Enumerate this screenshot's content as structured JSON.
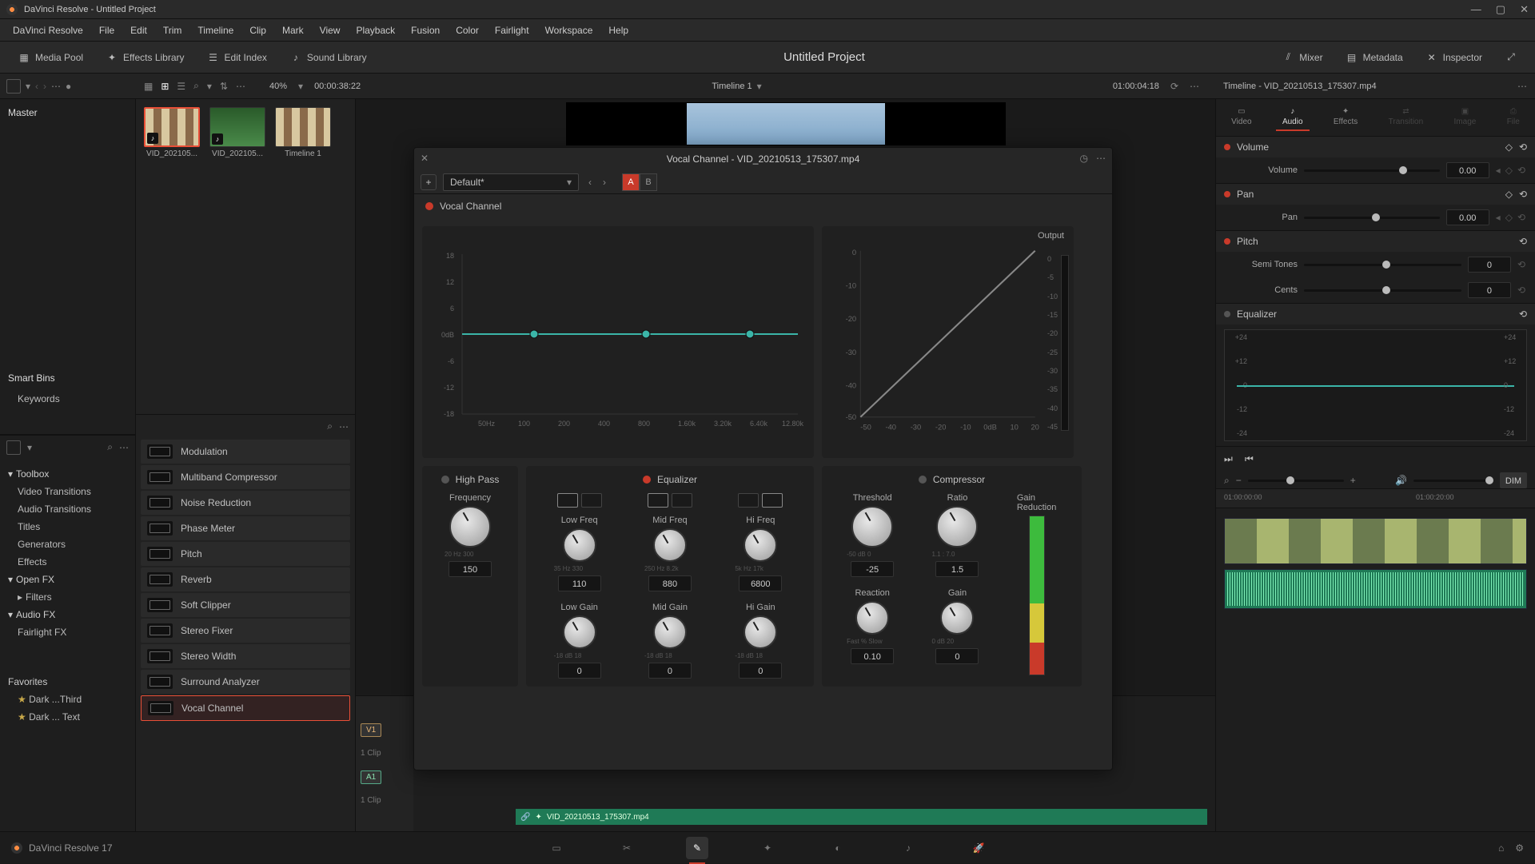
{
  "titlebar": {
    "text": "DaVinci Resolve - Untitled Project"
  },
  "menu": [
    "DaVinci Resolve",
    "File",
    "Edit",
    "Trim",
    "Timeline",
    "Clip",
    "Mark",
    "View",
    "Playback",
    "Fusion",
    "Color",
    "Fairlight",
    "Workspace",
    "Help"
  ],
  "sectoolbar": {
    "mediapool": "Media Pool",
    "effectslib": "Effects Library",
    "editindex": "Edit Index",
    "soundlib": "Sound Library",
    "project": "Untitled Project",
    "mixer": "Mixer",
    "metadata": "Metadata",
    "inspector": "Inspector"
  },
  "toolbarrow": {
    "zoom": "40%",
    "timecode_left": "00:00:38:22",
    "timeline_name": "Timeline 1",
    "timecode_right": "01:00:04:18"
  },
  "mediapool": {
    "master": "Master",
    "smartbins": "Smart Bins",
    "keywords": "Keywords",
    "thumbs": [
      {
        "label": "VID_202105..."
      },
      {
        "label": "VID_202105..."
      },
      {
        "label": "Timeline 1"
      }
    ]
  },
  "effectstree": {
    "toolbox": "Toolbox",
    "items": [
      "Video Transitions",
      "Audio Transitions",
      "Titles",
      "Generators",
      "Effects"
    ],
    "openfx": "Open FX",
    "filters": "Filters",
    "audiofx": "Audio FX",
    "fairlightfx": "Fairlight FX",
    "favorites": "Favorites",
    "favitems": [
      "Dark ...Third",
      "Dark ... Text"
    ]
  },
  "fxlist": [
    "Modulation",
    "Multiband Compressor",
    "Noise Reduction",
    "Phase Meter",
    "Pitch",
    "Reverb",
    "Soft Clipper",
    "Stereo Fixer",
    "Stereo Width",
    "Surround Analyzer",
    "Vocal Channel"
  ],
  "fxlist_selected": "Vocal Channel",
  "vocal_panel": {
    "title": "Vocal Channel - VID_20210513_175307.mp4",
    "preset": "Default*",
    "ab_a": "A",
    "ab_b": "B",
    "channel_label": "Vocal Channel",
    "output_label": "Output",
    "eq_ylabels": [
      "18",
      "12",
      "6",
      "0dB",
      "-6",
      "-12",
      "-18"
    ],
    "eq_xlabels": [
      "50Hz",
      "100",
      "200",
      "400",
      "800",
      "1.60k",
      "3.20k",
      "6.40k",
      "12.80k"
    ],
    "out_ylabels": [
      "0",
      "-10",
      "-20",
      "-30",
      "-40",
      "-50"
    ],
    "out_xlabels": [
      "-50",
      "-40",
      "-30",
      "-20",
      "-10",
      "0dB",
      "10",
      "20"
    ],
    "out_scale_r": [
      "0",
      "-5",
      "-10",
      "-15",
      "-20",
      "-25",
      "-30",
      "-35",
      "-40",
      "-45"
    ],
    "highpass": {
      "title": "High Pass",
      "freq_label": "Frequency",
      "scale": "20   Hz   300",
      "value": "150"
    },
    "equalizer": {
      "title": "Equalizer",
      "low": {
        "freq_label": "Low Freq",
        "freq_scale": "35   Hz   330",
        "freq_val": "110",
        "gain_label": "Low Gain",
        "gain_scale": "-18   dB   18",
        "gain_val": "0"
      },
      "mid": {
        "freq_label": "Mid Freq",
        "freq_scale": "250   Hz   8.2k",
        "freq_val": "880",
        "gain_label": "Mid Gain",
        "gain_scale": "-18   dB   18",
        "gain_val": "0"
      },
      "hi": {
        "freq_label": "Hi Freq",
        "freq_scale": "5k   Hz   17k",
        "freq_val": "6800",
        "gain_label": "Hi Gain",
        "gain_scale": "-18   dB   18",
        "gain_val": "0"
      }
    },
    "compressor": {
      "title": "Compressor",
      "threshold": {
        "label": "Threshold",
        "scale": "-50   dB   0",
        "val": "-25"
      },
      "ratio": {
        "label": "Ratio",
        "scale": "1.1 :   7.0",
        "val": "1.5"
      },
      "gr_label": "Gain Reduction",
      "reaction": {
        "label": "Reaction",
        "scale": "Fast   %   Slow",
        "val": "0.10"
      },
      "gain": {
        "label": "Gain",
        "scale": "0   dB   20",
        "val": "0"
      }
    }
  },
  "inspector": {
    "timeline_title": "Timeline - VID_20210513_175307.mp4",
    "tabs": [
      "Video",
      "Audio",
      "Effects",
      "Transition",
      "Image",
      "File"
    ],
    "active_tab": "Audio",
    "volume": {
      "section": "Volume",
      "label": "Volume",
      "val": "0.00"
    },
    "pan": {
      "section": "Pan",
      "label": "Pan",
      "val": "0.00"
    },
    "pitch": {
      "section": "Pitch",
      "semi_label": "Semi Tones",
      "semi_val": "0",
      "cents_label": "Cents",
      "cents_val": "0"
    },
    "equalizer": {
      "section": "Equalizer",
      "scale": [
        "+24",
        "+12",
        "0",
        "-12",
        "-24"
      ]
    },
    "timecodes": [
      "01:00:00:00",
      "01:00:20:00"
    ],
    "dim": "DIM"
  },
  "timeline": {
    "v1": "V1",
    "a1": "A1",
    "clip_count": "1 Clip",
    "start_time": "0",
    "audio_clip_name": "VID_20210513_175307.mp4"
  },
  "footer": {
    "version": "DaVinci Resolve 17"
  }
}
